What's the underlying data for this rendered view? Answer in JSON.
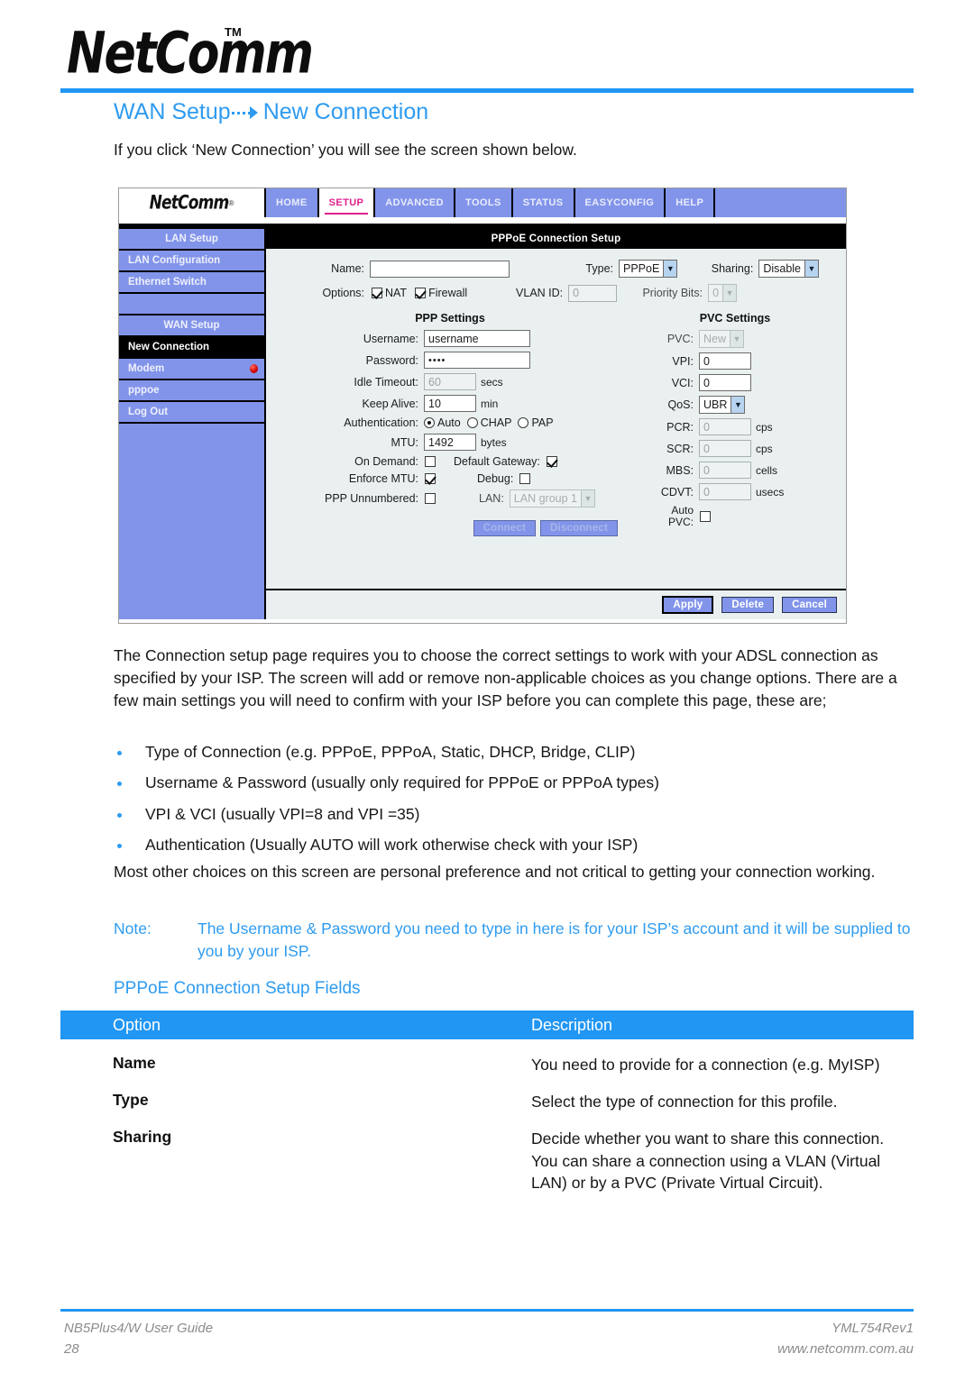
{
  "brand": {
    "logo_text": "NetComm",
    "logo_tm": "TM",
    "accent_color": "#2196f3"
  },
  "section": {
    "title_part1": "WAN Setup",
    "title_part2": "New Connection",
    "arrow": "dotted-arrow-icon"
  },
  "intro": "If you click ‘New Connection’ you will see the screen shown below.",
  "router": {
    "logo_text": "NetComm",
    "logo_reg": "®",
    "nav_tabs": [
      {
        "label": "HOME",
        "active": false
      },
      {
        "label": "SETUP",
        "active": true
      },
      {
        "label": "ADVANCED",
        "active": false
      },
      {
        "label": "TOOLS",
        "active": false
      },
      {
        "label": "STATUS",
        "active": false
      },
      {
        "label": "EASYCONFIG",
        "active": false
      },
      {
        "label": "HELP",
        "active": false
      }
    ],
    "sidebar": [
      {
        "label": "LAN Setup",
        "type": "header"
      },
      {
        "label": "LAN Configuration",
        "type": "item"
      },
      {
        "label": "Ethernet Switch",
        "type": "item"
      },
      {
        "label": "",
        "type": "blank"
      },
      {
        "label": "WAN Setup",
        "type": "header"
      },
      {
        "label": "New Connection",
        "type": "active"
      },
      {
        "label": "Modem",
        "type": "item",
        "status_dot": true
      },
      {
        "label": "pppoe",
        "type": "item"
      },
      {
        "label": "Log Out",
        "type": "item"
      }
    ],
    "panel_title": "PPPoE Connection Setup",
    "top_fields": {
      "name_label": "Name:",
      "name_value": "",
      "type_label": "Type:",
      "type_value": "PPPoE",
      "sharing_label": "Sharing:",
      "sharing_value": "Disable",
      "options_label": "Options:",
      "nat_label": "NAT",
      "nat_checked": true,
      "firewall_label": "Firewall",
      "firewall_checked": true,
      "vlan_id_label": "VLAN ID:",
      "vlan_id_value": "0",
      "priority_bits_label": "Priority Bits:",
      "priority_bits_value": "0"
    },
    "ppp": {
      "heading": "PPP Settings",
      "username_label": "Username:",
      "username_value": "username",
      "password_label": "Password:",
      "password_value": "••••",
      "idle_timeout_label": "Idle Timeout:",
      "idle_timeout_value": "60",
      "idle_timeout_unit": "secs",
      "keep_alive_label": "Keep Alive:",
      "keep_alive_value": "10",
      "keep_alive_unit": "min",
      "auth_label": "Authentication:",
      "auth_auto": "Auto",
      "auth_chap": "CHAP",
      "auth_pap": "PAP",
      "auth_selected": "Auto",
      "mtu_label": "MTU:",
      "mtu_value": "1492",
      "mtu_unit": "bytes",
      "on_demand_label": "On Demand:",
      "on_demand_checked": false,
      "default_gateway_label": "Default Gateway:",
      "default_gateway_checked": true,
      "enforce_mtu_label": "Enforce MTU:",
      "enforce_mtu_checked": true,
      "debug_label": "Debug:",
      "debug_checked": false,
      "ppp_unnumbered_label": "PPP Unnumbered:",
      "ppp_unnumbered_checked": false,
      "lan_label": "LAN:",
      "lan_value": "LAN group 1",
      "connect_label": "Connect",
      "disconnect_label": "Disconnect"
    },
    "pvc": {
      "heading": "PVC Settings",
      "pvc_label": "PVC:",
      "pvc_value": "New",
      "vpi_label": "VPI:",
      "vpi_value": "0",
      "vci_label": "VCI:",
      "vci_value": "0",
      "qos_label": "QoS:",
      "qos_value": "UBR",
      "pcr_label": "PCR:",
      "pcr_value": "0",
      "pcr_unit": "cps",
      "scr_label": "SCR:",
      "scr_value": "0",
      "scr_unit": "cps",
      "mbs_label": "MBS:",
      "mbs_value": "0",
      "mbs_unit": "cells",
      "cdvt_label": "CDVT:",
      "cdvt_value": "0",
      "cdvt_unit": "usecs",
      "auto_pvc_label_1": "Auto",
      "auto_pvc_label_2": "PVC:",
      "auto_pvc_checked": false
    },
    "footer_buttons": {
      "apply": "Apply",
      "delete": "Delete",
      "cancel": "Cancel"
    }
  },
  "body": {
    "paragraph1": "The Connection setup page requires you to choose the correct settings to work with your ADSL connection as specified by your ISP. The screen will add or remove non-applicable choices as you change options. There are a few main settings you will need to confirm with your ISP before you can complete this page, these are;",
    "bullets": [
      "Type of Connection (e.g. PPPoE, PPPoA, Static, DHCP, Bridge, CLIP)",
      "Username & Password (usually only required for PPPoE or PPPoA types)",
      "VPI & VCI (usually VPI=8 and VPI =35)",
      "Authentication (Usually AUTO will work otherwise check with your ISP)"
    ],
    "paragraph2": "Most other choices on this screen are personal preference and not critical to getting your connection working.",
    "note_label": "Note:",
    "note_text": "The Username & Password you need to type in here is for your ISP’s account and it will be supplied to you by your ISP."
  },
  "table": {
    "title": "PPPoE Connection Setup Fields",
    "header": {
      "option": "Option",
      "description": "Description"
    },
    "rows": [
      {
        "option": "Name",
        "description": "You need to provide for a connection (e.g. MyISP)"
      },
      {
        "option": "Type",
        "description": "Select the type of connection for this profile."
      },
      {
        "option": "Sharing",
        "description": "Decide whether you want to share this connection. You can share a connection using a VLAN (Virtual LAN) or by a PVC (Private Virtual Circuit)."
      }
    ]
  },
  "footer": {
    "guide": "NB5Plus4/W User Guide",
    "page_number": "28",
    "doc_code": "YML754Rev1",
    "website": "www.netcomm.com.au"
  }
}
